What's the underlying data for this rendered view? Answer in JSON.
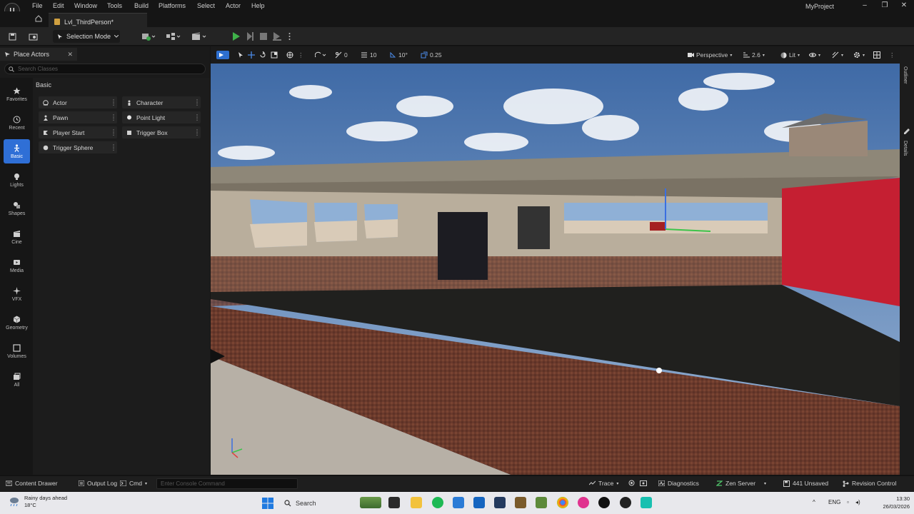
{
  "menubar": {
    "logo_label": "U",
    "items": [
      "File",
      "Edit",
      "Window",
      "Tools",
      "Build",
      "Platforms",
      "Select",
      "Actor",
      "Help"
    ],
    "project": "MyProject"
  },
  "tabs": {
    "level": "Lvl_ThirdPerson*"
  },
  "toolbar": {
    "selection_mode": "Selection Mode"
  },
  "place_actors": {
    "title": "Place Actors",
    "search_placeholder": "Search Classes",
    "categories": [
      {
        "label": "Favorites",
        "icon": "star-icon"
      },
      {
        "label": "Recent",
        "icon": "clock-icon"
      },
      {
        "label": "Basic",
        "icon": "basic-icon",
        "active": true
      },
      {
        "label": "Lights",
        "icon": "lightbulb-icon"
      },
      {
        "label": "Shapes",
        "icon": "shapes-icon"
      },
      {
        "label": "Cine",
        "icon": "clapper-icon"
      },
      {
        "label": "Media",
        "icon": "media-icon"
      },
      {
        "label": "VFX",
        "icon": "sparkle-icon"
      },
      {
        "label": "Geometry",
        "icon": "cube-icon"
      },
      {
        "label": "Volumes",
        "icon": "volume-icon"
      },
      {
        "label": "All",
        "icon": "all-icon"
      }
    ],
    "section": "Basic",
    "items": [
      {
        "label": "Actor",
        "icon": "actor-icon"
      },
      {
        "label": "Character",
        "icon": "character-icon"
      },
      {
        "label": "Pawn",
        "icon": "pawn-icon"
      },
      {
        "label": "Point Light",
        "icon": "point-light-icon"
      },
      {
        "label": "Player Start",
        "icon": "player-start-icon"
      },
      {
        "label": "Trigger Box",
        "icon": "trigger-box-icon"
      },
      {
        "label": "Trigger Sphere",
        "icon": "trigger-sphere-icon"
      }
    ]
  },
  "viewport": {
    "rotation_snap": "0",
    "grid_snap": "10",
    "angle_snap": "10°",
    "scale_snap": "0.25",
    "view_mode": "Perspective",
    "camera_speed": "2.6",
    "lighting": "Lit"
  },
  "right_tabs": {
    "outliner": "Outliner",
    "details": "Details"
  },
  "statusbar": {
    "content_drawer": "Content Drawer",
    "output_log": "Output Log",
    "cmd": "Cmd",
    "console_placeholder": "Enter Console Command",
    "trace": "Trace",
    "diagnostics": "Diagnostics",
    "zen_server": "Zen Server",
    "unsaved": "441 Unsaved",
    "revision_control": "Revision Control"
  },
  "taskbar": {
    "weather_line1": "Rainy days ahead",
    "weather_line2": "18°C",
    "search": "Search",
    "lang": "ENG",
    "time": "13:30",
    "date": "26/03/2026"
  }
}
